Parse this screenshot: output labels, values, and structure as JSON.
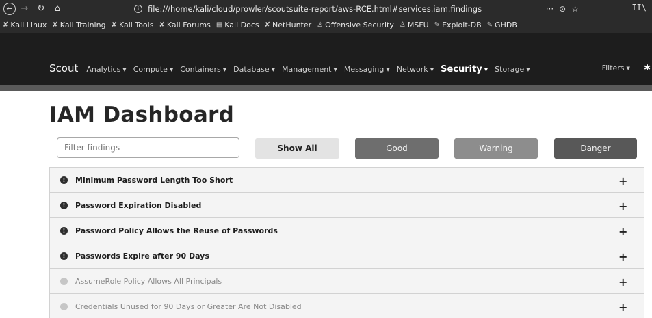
{
  "browser": {
    "url": "file:///home/kali/cloud/prowler/scoutsuite-report/aws-RCE.html#services.iam.findings",
    "url_actions": [
      "···",
      "⊙",
      "☆"
    ],
    "bookmarks": [
      {
        "label": "Kali Linux",
        "icon": "kali-dragon-icon"
      },
      {
        "label": "Kali Training",
        "icon": "kali-icon"
      },
      {
        "label": "Kali Tools",
        "icon": "kali-icon"
      },
      {
        "label": "Kali Forums",
        "icon": "kali-icon"
      },
      {
        "label": "Kali Docs",
        "icon": "docs-icon"
      },
      {
        "label": "NetHunter",
        "icon": "kali-dragon-icon"
      },
      {
        "label": "Offensive Security",
        "icon": "offsec-icon"
      },
      {
        "label": "MSFU",
        "icon": "offsec-icon"
      },
      {
        "label": "Exploit-DB",
        "icon": "exploitdb-icon"
      },
      {
        "label": "GHDB",
        "icon": "exploitdb-icon"
      }
    ]
  },
  "navbar": {
    "brand": "Scout",
    "menus": [
      {
        "label": "Analytics",
        "active": false
      },
      {
        "label": "Compute",
        "active": false
      },
      {
        "label": "Containers",
        "active": false
      },
      {
        "label": "Database",
        "active": false
      },
      {
        "label": "Management",
        "active": false
      },
      {
        "label": "Messaging",
        "active": false
      },
      {
        "label": "Network",
        "active": false
      },
      {
        "label": "Security",
        "active": true
      },
      {
        "label": "Storage",
        "active": false
      }
    ],
    "filters_label": "Filters"
  },
  "page": {
    "title": "IAM Dashboard",
    "filter_placeholder": "Filter findings",
    "buttons": {
      "show_all": "Show All",
      "good": "Good",
      "warning": "Warning",
      "danger": "Danger"
    }
  },
  "findings": [
    {
      "label": "Minimum Password Length Too Short",
      "level": "danger"
    },
    {
      "label": "Password Expiration Disabled",
      "level": "danger"
    },
    {
      "label": "Password Policy Allows the Reuse of Passwords",
      "level": "danger"
    },
    {
      "label": "Passwords Expire after 90 Days",
      "level": "danger"
    },
    {
      "label": "AssumeRole Policy Allows All Principals",
      "level": "good"
    },
    {
      "label": "Credentials Unused for 90 Days or Greater Are Not Disabled",
      "level": "good"
    }
  ]
}
